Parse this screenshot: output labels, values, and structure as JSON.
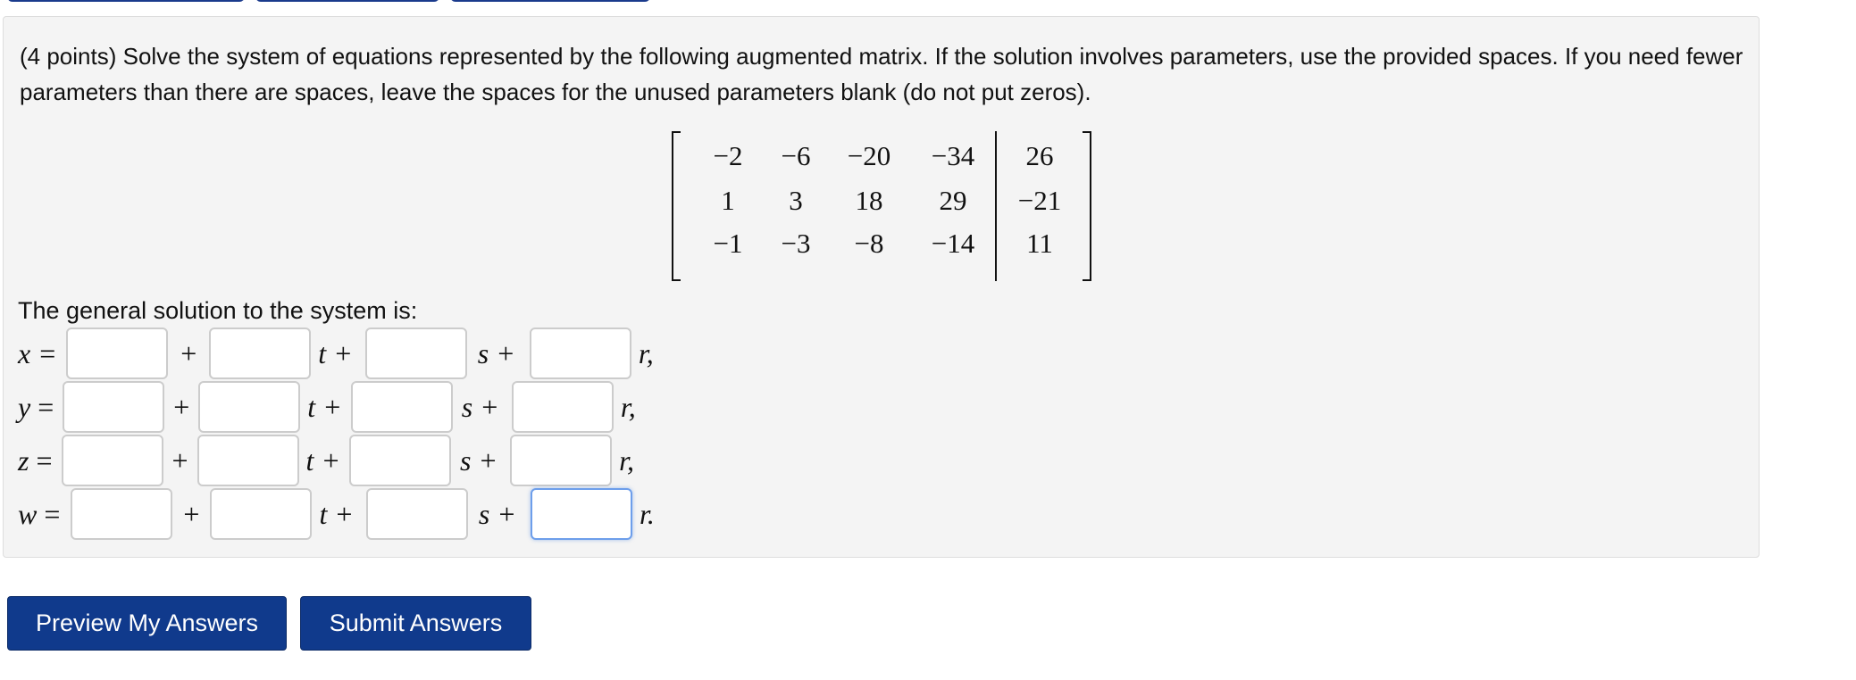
{
  "prompt": "(4 points) Solve the system of equations represented by the following augmented matrix. If the solution involves parameters, use the provided spaces. If you need fewer parameters than there are spaces, leave the spaces for the unused parameters blank (do not put zeros).",
  "matrix": {
    "rows": [
      [
        "−2",
        "−6",
        "−20",
        "−34",
        "26"
      ],
      [
        "1",
        "3",
        "18",
        "29",
        "−21"
      ],
      [
        "−1",
        "−3",
        "−8",
        "−14",
        "11"
      ]
    ]
  },
  "general_solution_label": "The general solution to the system is:",
  "equations": [
    {
      "var": "x",
      "eq": "=",
      "plus": "+",
      "t": "t +",
      "s": "s +",
      "r": "r,",
      "values": [
        "",
        "",
        "",
        ""
      ]
    },
    {
      "var": "y",
      "eq": "=",
      "plus": "+",
      "t": "t +",
      "s": "s +",
      "r": "r,",
      "values": [
        "",
        "",
        "",
        ""
      ]
    },
    {
      "var": "z",
      "eq": "=",
      "plus": "+",
      "t": "t +",
      "s": "s +",
      "r": "r,",
      "values": [
        "",
        "",
        "",
        ""
      ]
    },
    {
      "var": "w",
      "eq": "=",
      "plus": "+",
      "t": "t +",
      "s": "s +",
      "r": "r.",
      "values": [
        "",
        "",
        "",
        ""
      ]
    }
  ],
  "buttons": {
    "preview": "Preview My Answers",
    "submit": "Submit Answers"
  },
  "colors": {
    "button_bg": "#103a8c",
    "panel_bg": "#f4f4f4",
    "focus_border": "#6d9eeb"
  }
}
